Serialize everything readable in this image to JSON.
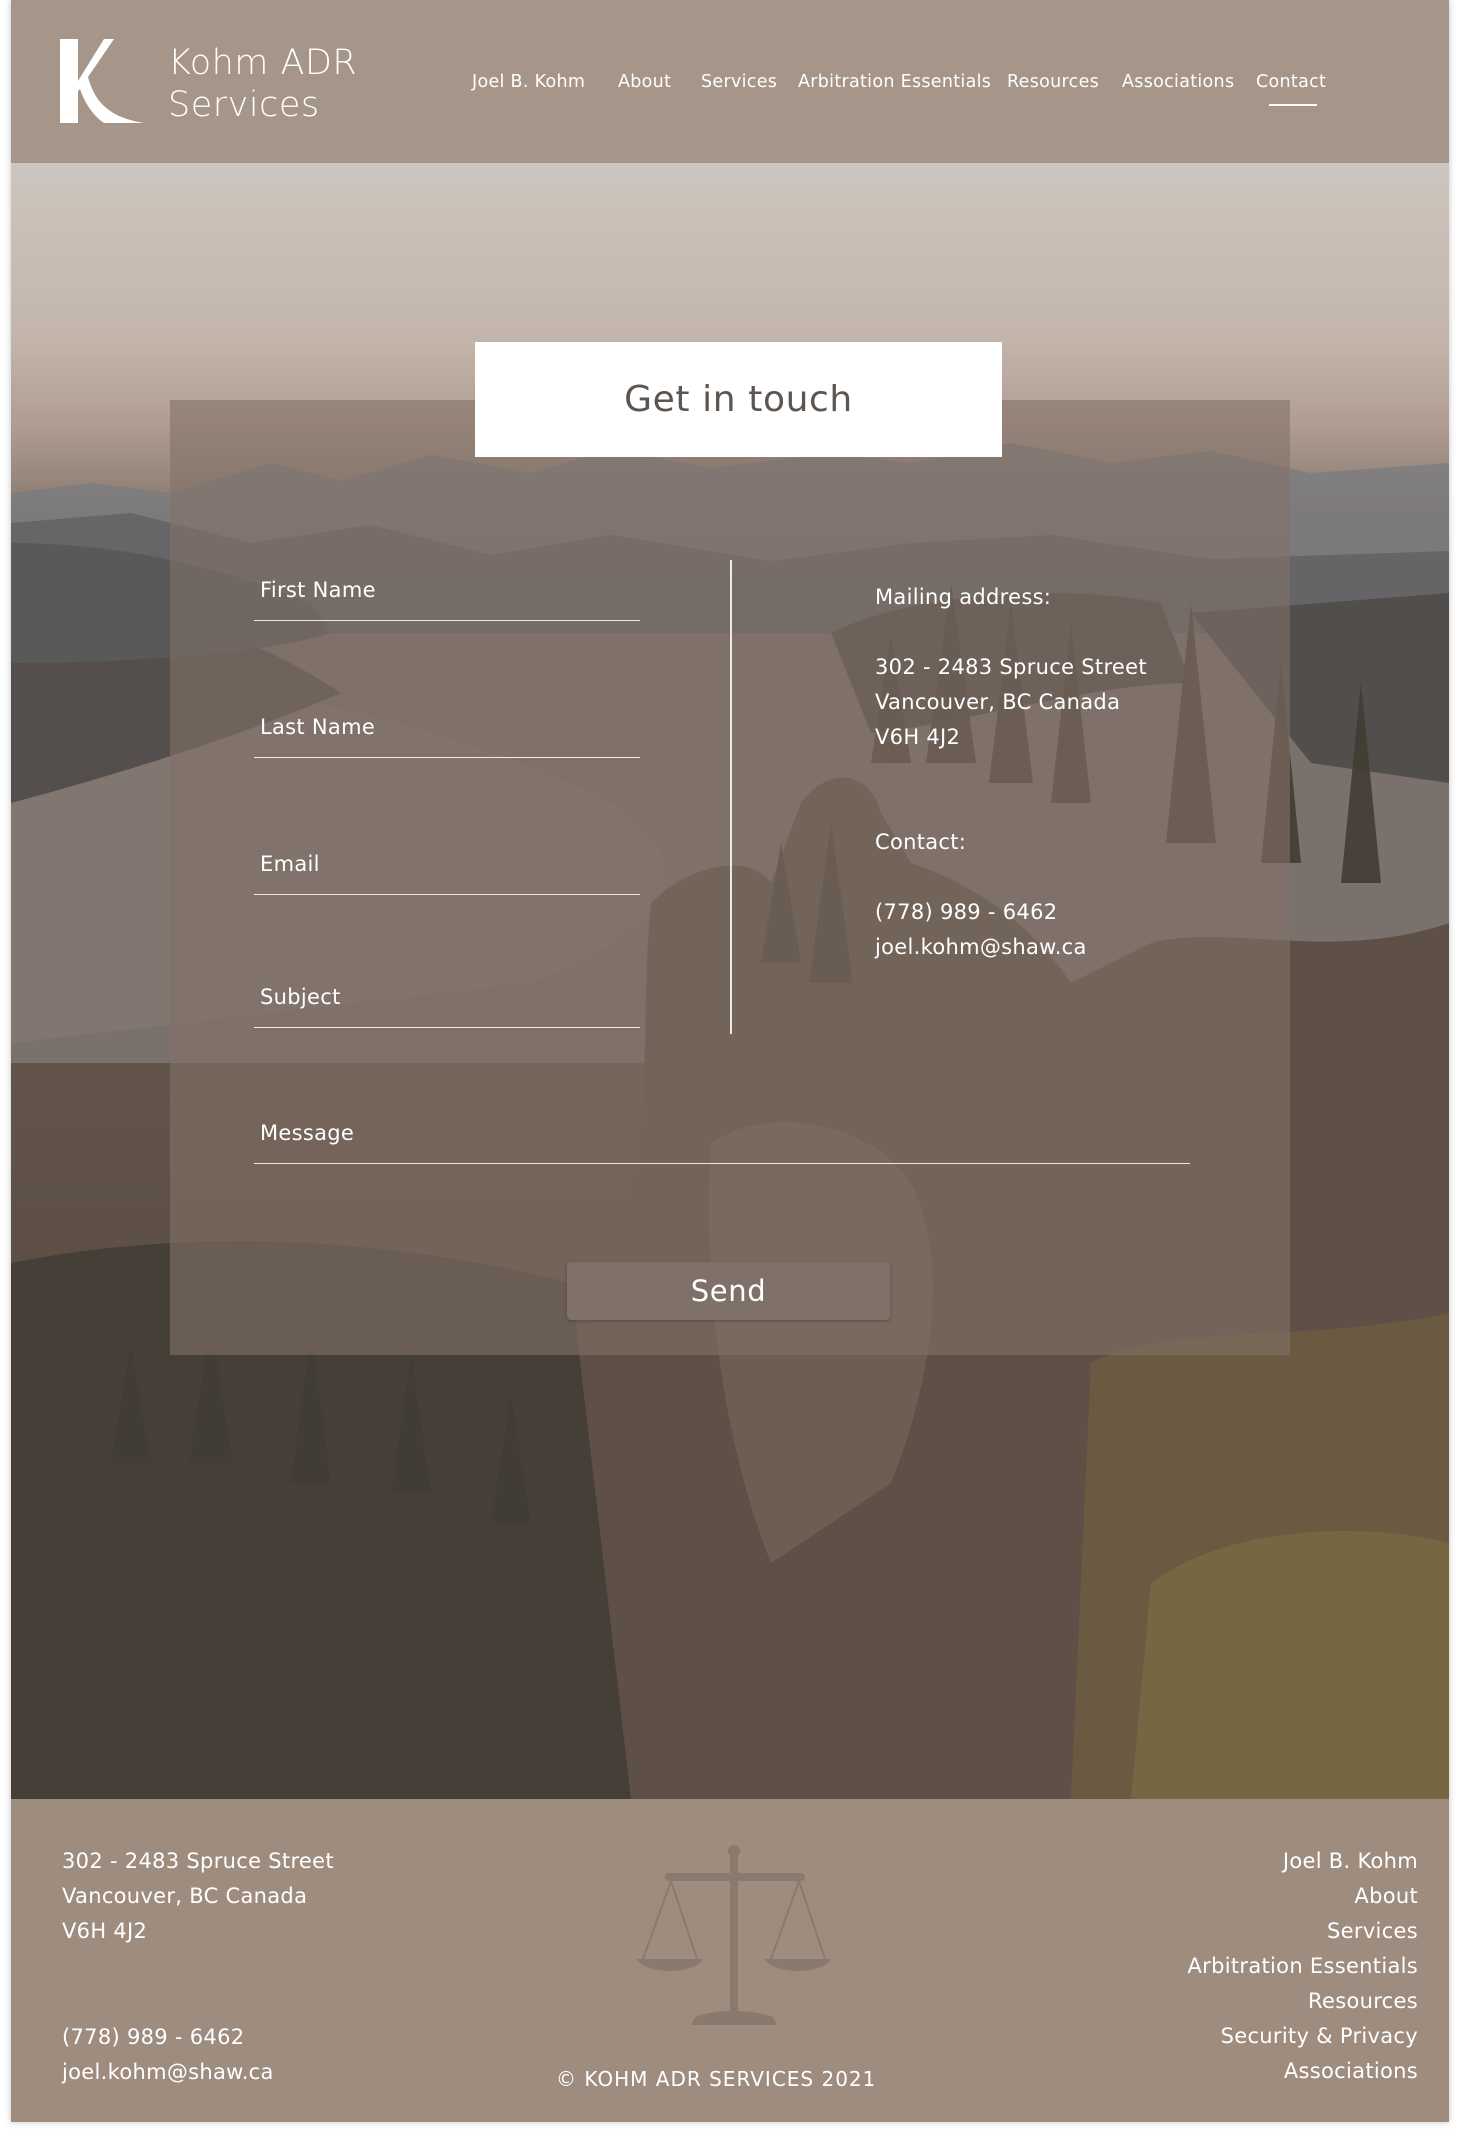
{
  "brand": {
    "logo_icon": "k-letter-logo-icon",
    "name_line1": "Kohm ADR",
    "name_line2": "Services"
  },
  "nav": {
    "items": [
      {
        "label": "Joel B. Kohm"
      },
      {
        "label": "About"
      },
      {
        "label": "Services"
      },
      {
        "label": "Arbitration Essentials"
      },
      {
        "label": "Resources"
      },
      {
        "label": "Associations"
      },
      {
        "label": "Contact",
        "active": true
      }
    ]
  },
  "contact_form": {
    "title": "Get in touch",
    "fields": {
      "first_name": "First Name",
      "last_name": "Last Name",
      "email": "Email",
      "subject": "Subject",
      "message": "Message"
    },
    "send_label": "Send"
  },
  "info": {
    "mailing_heading": "Mailing address:",
    "address_line1": "302 - 2483 Spruce Street",
    "address_line2": "Vancouver, BC Canada",
    "address_line3": "V6H 4J2",
    "contact_heading": "Contact:",
    "phone": "(778) 989 - 6462",
    "email": "joel.kohm@shaw.ca"
  },
  "footer": {
    "address_line1": "302 - 2483 Spruce Street",
    "address_line2": "Vancouver, BC Canada",
    "address_line3": "V6H 4J2",
    "phone": "(778) 989 - 6462",
    "email": "joel.kohm@shaw.ca",
    "emblem_icon": "scales-of-justice-icon",
    "copyright": "© KOHM ADR SERVICES  2021",
    "links": [
      {
        "label": "Joel B. Kohm"
      },
      {
        "label": "About"
      },
      {
        "label": "Services"
      },
      {
        "label": "Arbitration Essentials"
      },
      {
        "label": "Resources"
      },
      {
        "label": "Security & Privacy"
      },
      {
        "label": "Associations"
      }
    ]
  },
  "colors": {
    "header_bg": "#a69689",
    "footer_bg": "#9e8c7f",
    "card_overlay": "#827268",
    "send_button": "#7f7168",
    "title_text": "#5c5550"
  }
}
